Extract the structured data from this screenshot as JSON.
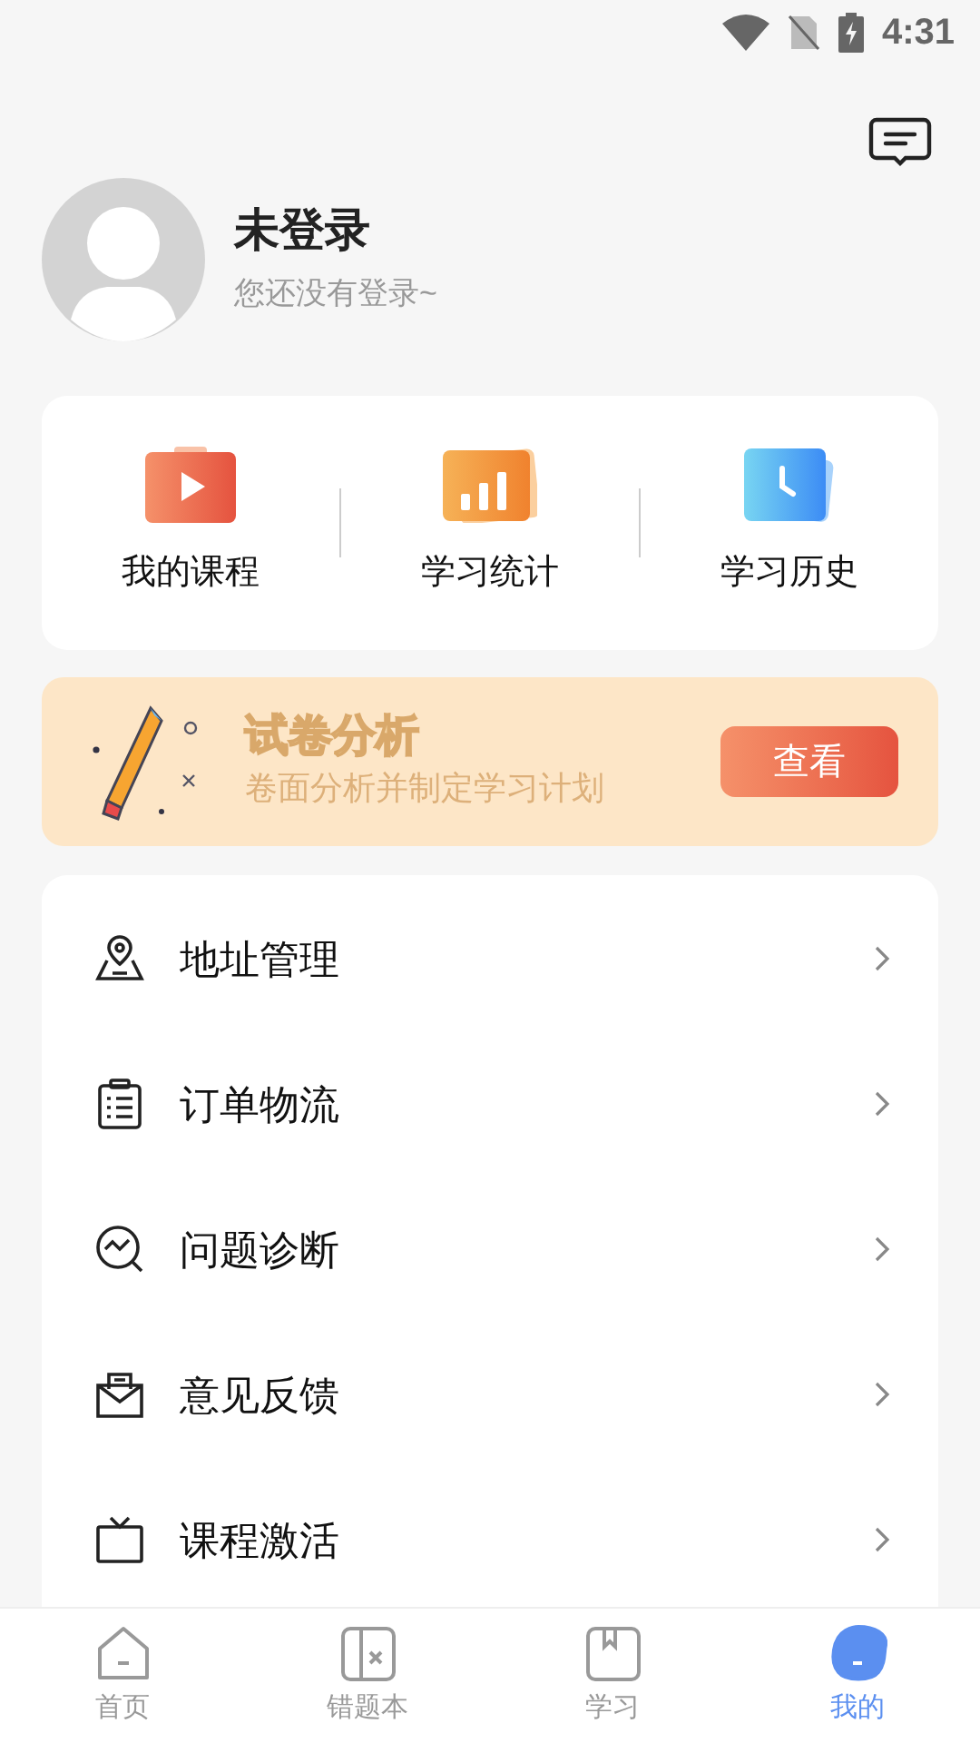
{
  "status_bar": {
    "time": "4:31"
  },
  "profile": {
    "name": "未登录",
    "subtitle": "您还没有登录~"
  },
  "shortcuts": [
    {
      "kind": "course",
      "label": "我的课程"
    },
    {
      "kind": "stats",
      "label": "学习统计"
    },
    {
      "kind": "history",
      "label": "学习历史"
    }
  ],
  "banner": {
    "title": "试卷分析",
    "subtitle": "卷面分析并制定学习计划",
    "button": "查看"
  },
  "menu": [
    {
      "kind": "address",
      "label": "地址管理"
    },
    {
      "kind": "order",
      "label": "订单物流"
    },
    {
      "kind": "diagnose",
      "label": "问题诊断"
    },
    {
      "kind": "feedback",
      "label": "意见反馈"
    },
    {
      "kind": "activate",
      "label": "课程激活"
    }
  ],
  "tab_bar": [
    {
      "kind": "home",
      "label": "首页",
      "selected": false
    },
    {
      "kind": "mistakes",
      "label": "错题本",
      "selected": false
    },
    {
      "kind": "study",
      "label": "学习",
      "selected": false
    },
    {
      "kind": "me",
      "label": "我的",
      "selected": true
    }
  ]
}
